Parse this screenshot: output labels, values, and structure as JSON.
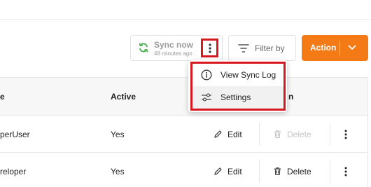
{
  "toolbar": {
    "sync_label": "Sync now",
    "sync_subtext": "48 minutes ago",
    "filter_label": "Filter by",
    "action_label": "Action"
  },
  "table": {
    "headers": [
      "e",
      "Active",
      "n"
    ],
    "rows": [
      {
        "name": "perUser",
        "active": "Yes",
        "edit": "Edit",
        "delete": "Delete",
        "delete_enabled": false
      },
      {
        "name": "reloper",
        "active": "Yes",
        "edit": "Edit",
        "delete": "Delete",
        "delete_enabled": true
      }
    ]
  },
  "menu": {
    "items": [
      {
        "label": "View Sync Log",
        "icon": "info-icon"
      },
      {
        "label": "Settings",
        "icon": "sliders-icon"
      }
    ]
  },
  "colors": {
    "accent": "#f37a14",
    "highlight": "#d7191f",
    "sync_icon": "#4caf50"
  }
}
